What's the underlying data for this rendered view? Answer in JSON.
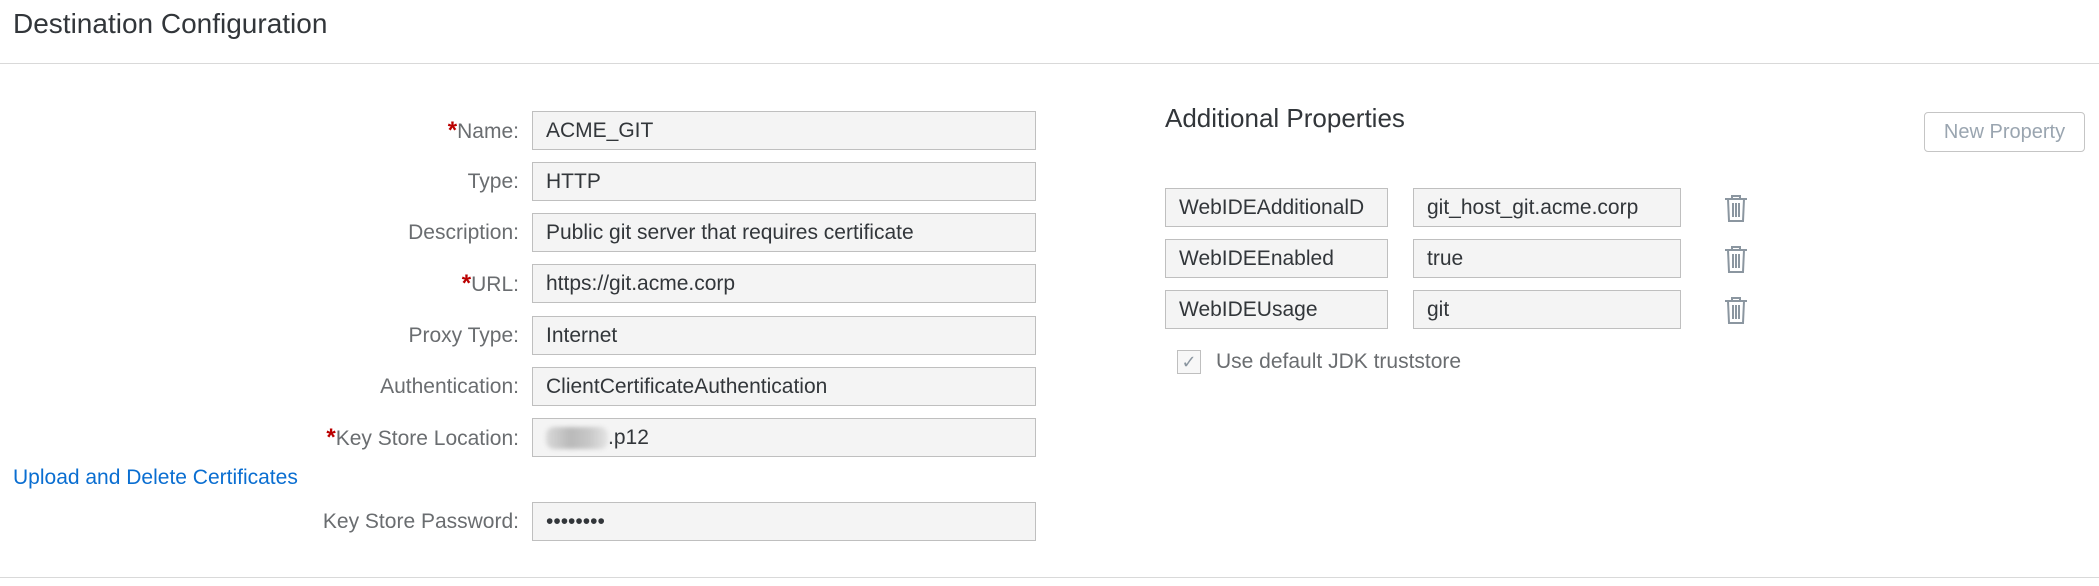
{
  "page": {
    "title": "Destination Configuration"
  },
  "form": {
    "fields": [
      {
        "label": "Name:",
        "required": true,
        "value": "ACME_GIT"
      },
      {
        "label": "Type:",
        "required": false,
        "value": "HTTP"
      },
      {
        "label": "Description:",
        "required": false,
        "value": "Public git server that requires certificate"
      },
      {
        "label": "URL:",
        "required": true,
        "value": "https://git.acme.corp"
      },
      {
        "label": "Proxy Type:",
        "required": false,
        "value": "Internet"
      },
      {
        "label": "Authentication:",
        "required": false,
        "value": "ClientCertificateAuthentication"
      },
      {
        "label": "Key Store Location:",
        "required": true,
        "value": ".p12"
      },
      {
        "label": "Key Store Password:",
        "required": false,
        "value": "••••••••"
      }
    ],
    "required_marker": "*",
    "upload_link": "Upload and Delete Certificates"
  },
  "additional": {
    "title": "Additional Properties",
    "new_property_button": "New Property",
    "properties": [
      {
        "key": "WebIDEAdditionalD",
        "value": "git_host_git.acme.corp"
      },
      {
        "key": "WebIDEEnabled",
        "value": "true"
      },
      {
        "key": "WebIDEUsage",
        "value": "git"
      }
    ],
    "checkbox": {
      "label": "Use default JDK truststore",
      "checked": true,
      "mark": "✓"
    }
  },
  "colors": {
    "required": "#bb0000",
    "link": "#0a6ed1",
    "field_bg": "#f4f4f4",
    "icon": "#8b96a0"
  }
}
